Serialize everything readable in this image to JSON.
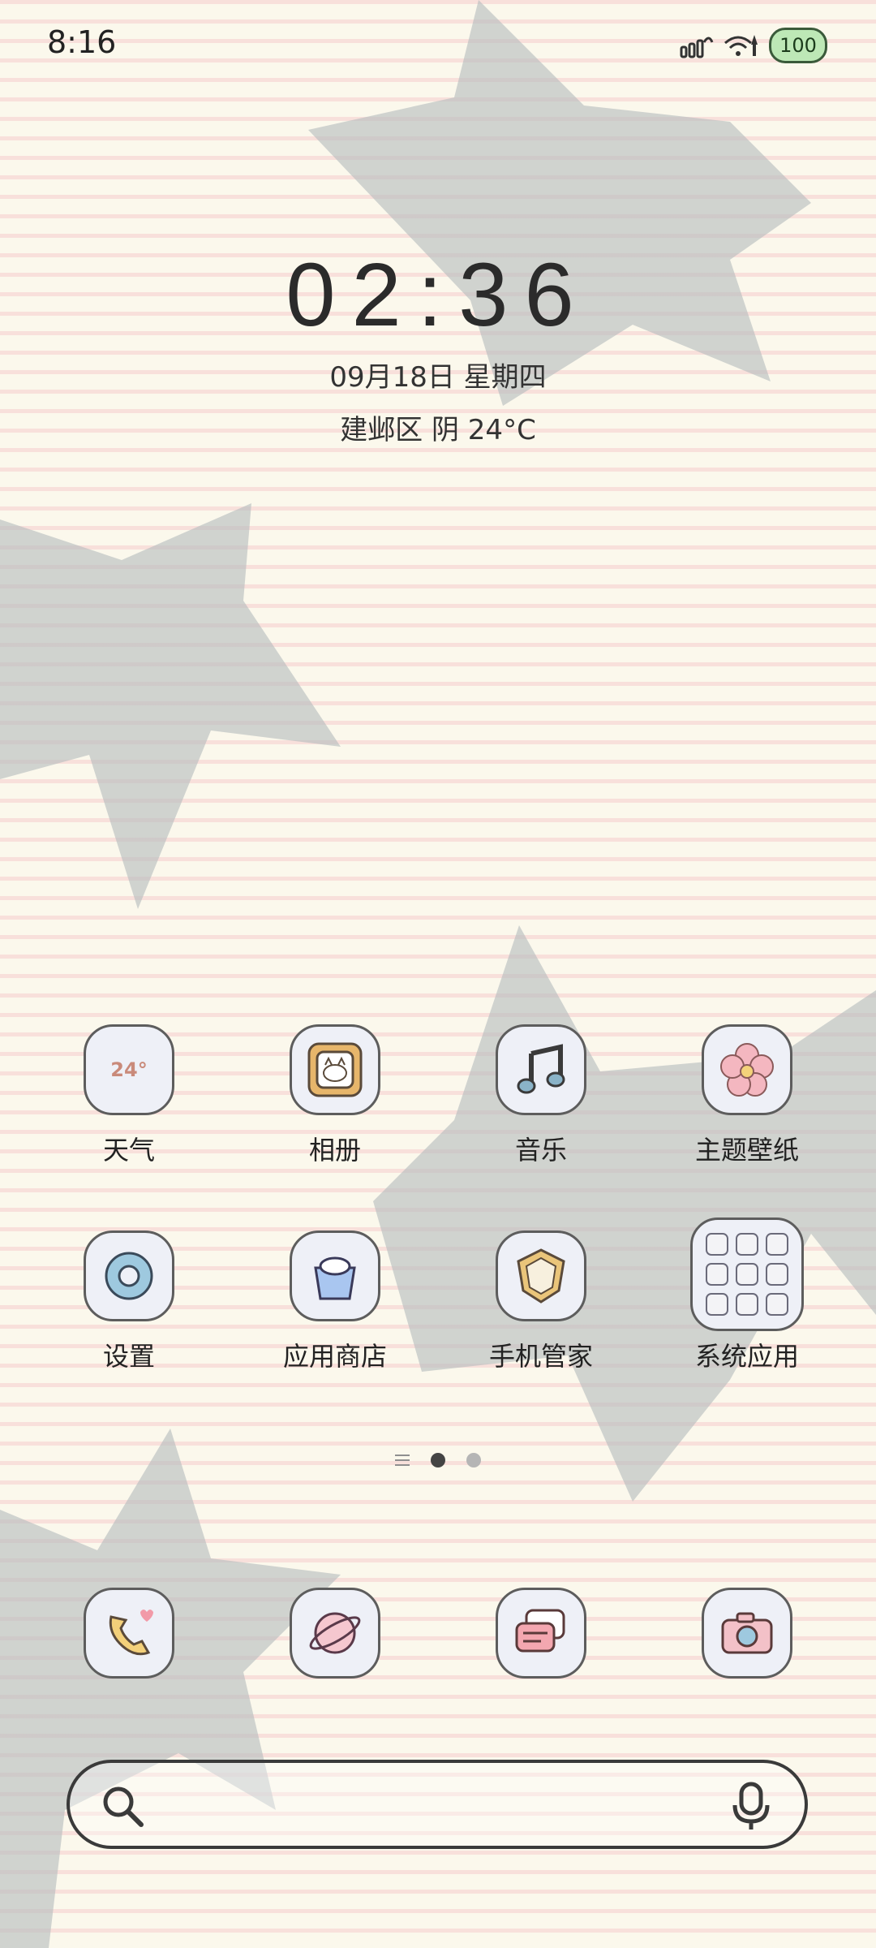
{
  "status_bar": {
    "time": "8:16",
    "battery": "100"
  },
  "clock": {
    "time": "02:36",
    "date": "09月18日 星期四",
    "weather": "建邺区 阴 24°C"
  },
  "apps_row1": [
    {
      "label": "天气",
      "icon": "weather-icon",
      "icon_text": "24°"
    },
    {
      "label": "相册",
      "icon": "gallery-icon"
    },
    {
      "label": "音乐",
      "icon": "music-icon"
    },
    {
      "label": "主题壁纸",
      "icon": "theme-flower-icon"
    }
  ],
  "apps_row2": [
    {
      "label": "设置",
      "icon": "settings-gear-icon"
    },
    {
      "label": "应用商店",
      "icon": "app-store-bag-icon"
    },
    {
      "label": "手机管家",
      "icon": "phone-manager-shield-icon"
    },
    {
      "label": "系统应用",
      "icon": "system-apps-folder-icon"
    }
  ],
  "dock": [
    {
      "icon": "phone-icon"
    },
    {
      "icon": "browser-planet-icon"
    },
    {
      "icon": "messages-icon"
    },
    {
      "icon": "camera-icon"
    }
  ],
  "page_indicator": {
    "pages": 2,
    "active": 0
  },
  "colors": {
    "background": "#fbf8ec",
    "stripe": "#f5cdcd",
    "star": "#b9bfc0"
  }
}
